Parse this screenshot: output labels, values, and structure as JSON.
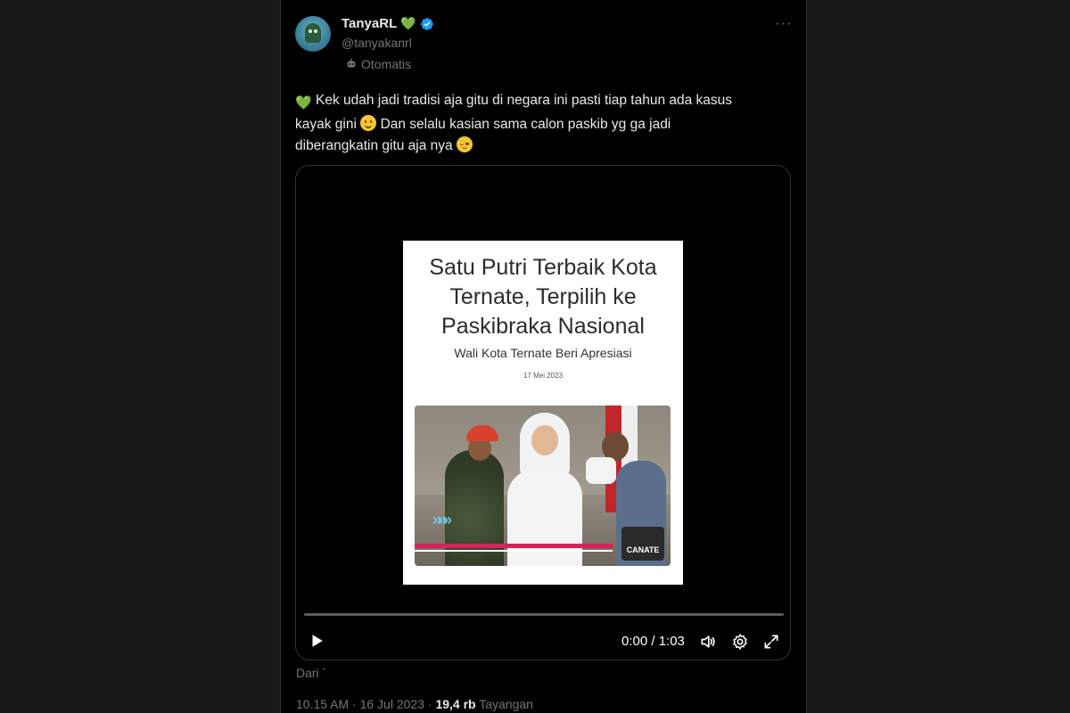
{
  "author": {
    "name": "TanyaRL",
    "handle": "@tanyakanrl",
    "automated_label": "Otomatis"
  },
  "tweet": {
    "line1": "Kek udah jadi tradisi aja gitu di negara ini pasti tiap tahun ada kasus",
    "line2a": "kayak gini",
    "line2b": "Dan selalu kasian sama calon paskib yg ga jadi",
    "line3": "diberangkatin gitu aja nya"
  },
  "video": {
    "poster_title_1": "Satu Putri Terbaik Kota",
    "poster_title_2": "Ternate, Terpilih ke",
    "poster_title_3": "Paskibraka Nasional",
    "poster_subtitle": "Wali Kota Ternate Beri Apresiasi",
    "poster_date": "17 Mei 2023",
    "poster_logo": "CANATE",
    "time": "0:00 / 1:03",
    "progress": 0
  },
  "source_label": "Dari `",
  "footer": {
    "timestamp": "10.15 AM · 16 Jul 2023 · ",
    "views_count": "19,4 rb",
    "views_label": " Tayangan"
  },
  "icons": {
    "heart_color": "#3fc45a",
    "verified_color": "#1d9bf0"
  }
}
